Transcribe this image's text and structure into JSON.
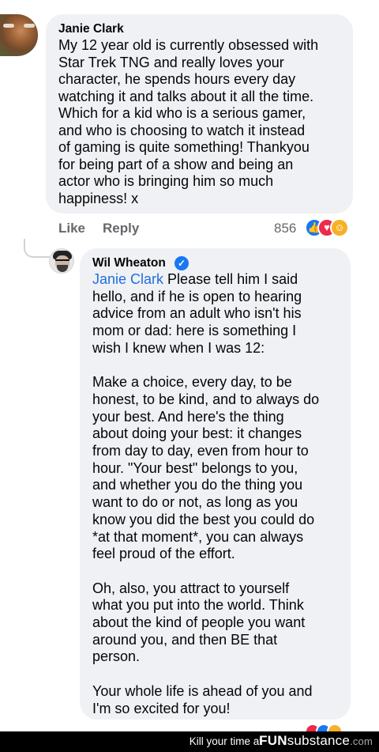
{
  "comment": {
    "author": "Janie Clark",
    "text": "My 12 year old is currently obsessed with\nStar Trek TNG and really loves your\ncharacter, he spends hours every day\nwatching it and talks about it all the time.\nWhich for a kid who is a serious gamer,\nand who is choosing to watch it instead\nof gaming is quite something! Thankyou\nfor being part of a show and being an\nactor who is bringing him so much\nhappiness! x",
    "like_label": "Like",
    "reply_label": "Reply",
    "reaction_count": "856"
  },
  "reply": {
    "author": "Wil Wheaton",
    "mention": "Janie Clark",
    "text": " Please tell him I said\nhello, and if he is open to hearing\nadvice from an adult who isn't his\nmom or dad: here is something I\nwish I knew when I was 12:\n\nMake a choice, every day, to be\nhonest, to be kind, and to always do\nyour best. And here's the thing\nabout doing your best: it changes\nfrom day to day, even from hour to\nhour. \"Your best\" belongs to you,\nand whether you do the thing you\nwant to do or not, as long as you\nknow you did the best you could do\n*at that moment*, you can always\nfeel proud of the effort.\n\nOh, also, you attract to yourself\nwhat you put into the world. Think\nabout the kind of people you want\naround you, and then BE that\nperson.\n\nYour whole life is ahead of you and\nI'm so excited for you!"
  },
  "footer": {
    "tagline": "Kill your time at",
    "logo_fun": "FUN",
    "logo_sub": "substance",
    "logo_dot": ".com"
  },
  "icons": {
    "reactions": [
      "like-icon",
      "love-icon",
      "care-icon"
    ],
    "verified": "verified-badge-icon"
  },
  "colors": {
    "bubble": "#eff1f4",
    "mention": "#216fdb",
    "meta": "#65676b",
    "like": "#1877f2",
    "love": "#f02849",
    "care": "#f7b125"
  }
}
